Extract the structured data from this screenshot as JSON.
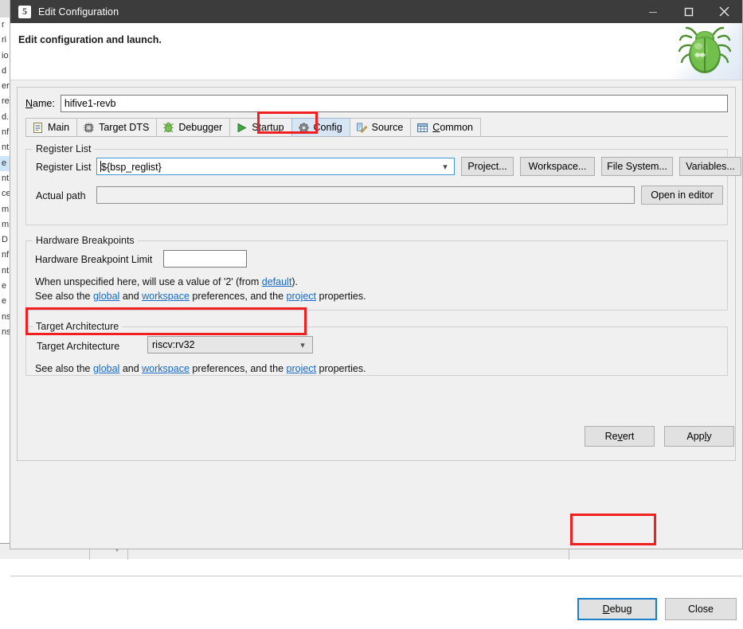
{
  "window": {
    "title": "Edit Configuration",
    "app_icon": "eclipse-icon",
    "minimize_label": "—",
    "maximize_label": "□",
    "close_label": "✕"
  },
  "header": {
    "title": "Edit configuration and launch.",
    "icon": "green-bug-icon"
  },
  "name_row": {
    "label": "Name:",
    "label_mnemonic": "N",
    "value": "hifive1-revb"
  },
  "tabs": [
    {
      "label": "Main",
      "icon": "document-icon",
      "active": false
    },
    {
      "label": "Target DTS",
      "icon": "chip-icon",
      "active": false
    },
    {
      "label": "Debugger",
      "icon": "debug-bug-icon",
      "active": false
    },
    {
      "label": "Startup",
      "icon": "green-play-icon",
      "active": false
    },
    {
      "label": "Config",
      "icon": "gear-icon",
      "active": true
    },
    {
      "label": "Source",
      "icon": "source-folder-icon",
      "active": false
    },
    {
      "label": "Common",
      "icon": "table-icon",
      "active": false
    }
  ],
  "register_list_group": {
    "title": "Register List",
    "field_label": "Register List",
    "field_value": "${bsp_reglist}",
    "actual_path_label": "Actual path",
    "actual_path_value": "",
    "buttons": [
      "Project...",
      "Workspace...",
      "File System...",
      "Variables..."
    ],
    "open_in_editor": "Open in editor"
  },
  "hardware_breakpoints_group": {
    "title": "Hardware Breakpoints",
    "limit_label": "Hardware Breakpoint Limit",
    "limit_value": "",
    "line1_pre": "When unspecified here, will use a value of '2' (from ",
    "line1_link": "default",
    "line1_post": ").",
    "line2_pre": "See also the ",
    "line2_link1": "global",
    "line2_mid1": " and ",
    "line2_link2": "workspace",
    "line2_mid2": " preferences, and the ",
    "line2_link3": "project",
    "line2_post": " properties."
  },
  "target_architecture_group": {
    "title": "Target Architecture",
    "field_label": "Target Architecture",
    "field_value": "riscv:rv32",
    "line_pre": "See also the ",
    "line_link1": "global",
    "line_mid1": " and ",
    "line_link2": "workspace",
    "line_mid2": " preferences, and the ",
    "line_link3": "project",
    "line_post": " properties."
  },
  "action_buttons": {
    "revert": "Revert",
    "revert_mnemonic": "v",
    "apply": "Apply",
    "apply_mnemonic": "y",
    "debug": "Debug",
    "debug_mnemonic": "D",
    "close": "Close"
  },
  "highlights": {
    "color": "#f02020",
    "regions": [
      "config-tab",
      "target-architecture-row",
      "debug-button"
    ]
  },
  "background_app": {
    "left_column_lines": [
      "r",
      "ri",
      "io",
      "d",
      "er",
      "re",
      "d.",
      "nf",
      "nt",
      "e",
      "nt",
      "ce",
      "m",
      "m",
      "D",
      "nf",
      "nt",
      "e",
      "e",
      "ns",
      "ns"
    ],
    "selected_line_index": 9
  }
}
